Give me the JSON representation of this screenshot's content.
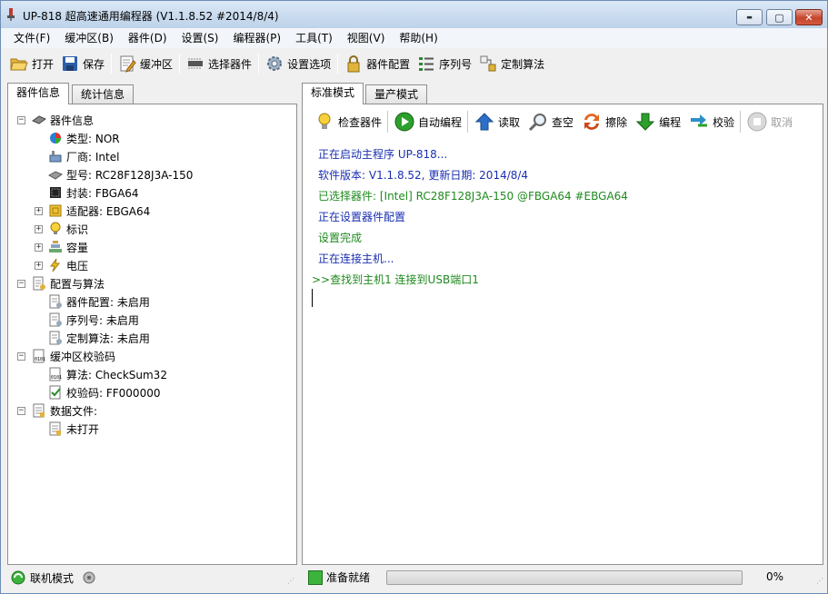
{
  "window": {
    "title": "UP-818 超高速通用编程器  (V1.1.8.52 #2014/8/4)",
    "controls": {
      "minimize": "▬",
      "maximize": "▢",
      "close": "✕"
    }
  },
  "menu": [
    "文件(F)",
    "缓冲区(B)",
    "器件(D)",
    "设置(S)",
    "编程器(P)",
    "工具(T)",
    "视图(V)",
    "帮助(H)"
  ],
  "toolbar": {
    "open": "打开",
    "save": "保存",
    "buffer": "缓冲区",
    "select_device": "选择器件",
    "settings": "设置选项",
    "device_config": "器件配置",
    "serial": "序列号",
    "custom_algo": "定制算法"
  },
  "left_tabs": [
    "器件信息",
    "统计信息"
  ],
  "right_tabs": [
    "标准模式",
    "量产模式"
  ],
  "tree": {
    "device_info": "器件信息",
    "type": "类型: NOR",
    "vendor": "厂商: Intel",
    "model": "型号: RC28F128J3A-150",
    "package": "封装: FBGA64",
    "adapter": "适配器: EBGA64",
    "marking": "标识",
    "capacity": "容量",
    "voltage": "电压",
    "config_algo": "配置与算法",
    "device_config": "器件配置: 未启用",
    "serial": "序列号: 未启用",
    "custom_algo": "定制算法: 未启用",
    "checksum": "缓冲区校验码",
    "algorithm": "算法: CheckSum32",
    "check_code": "校验码: FF000000",
    "data_file": "数据文件:",
    "not_open": "未打开"
  },
  "actions": {
    "check_device": "检查器件",
    "auto_program": "自动编程",
    "read": "读取",
    "blank_check": "查空",
    "erase": "擦除",
    "program": "编程",
    "verify": "校验",
    "cancel": "取消"
  },
  "log": [
    "正在启动主程序 UP-818...",
    "软件版本: V1.1.8.52, 更新日期: 2014/8/4",
    "已选择器件: [Intel] RC28F128J3A-150 @FBGA64 #EBGA64",
    "正在设置器件配置",
    "设置完成",
    "正在连接主机...",
    ">>查找到主机1 连接到USB端口1"
  ],
  "status": {
    "online_mode": "联机模式",
    "ready": "准备就绪",
    "progress_text": "0%",
    "progress_value": 0
  },
  "colors": {
    "log_blue": "#1a2fb0",
    "log_green": "#1f8a1f"
  }
}
